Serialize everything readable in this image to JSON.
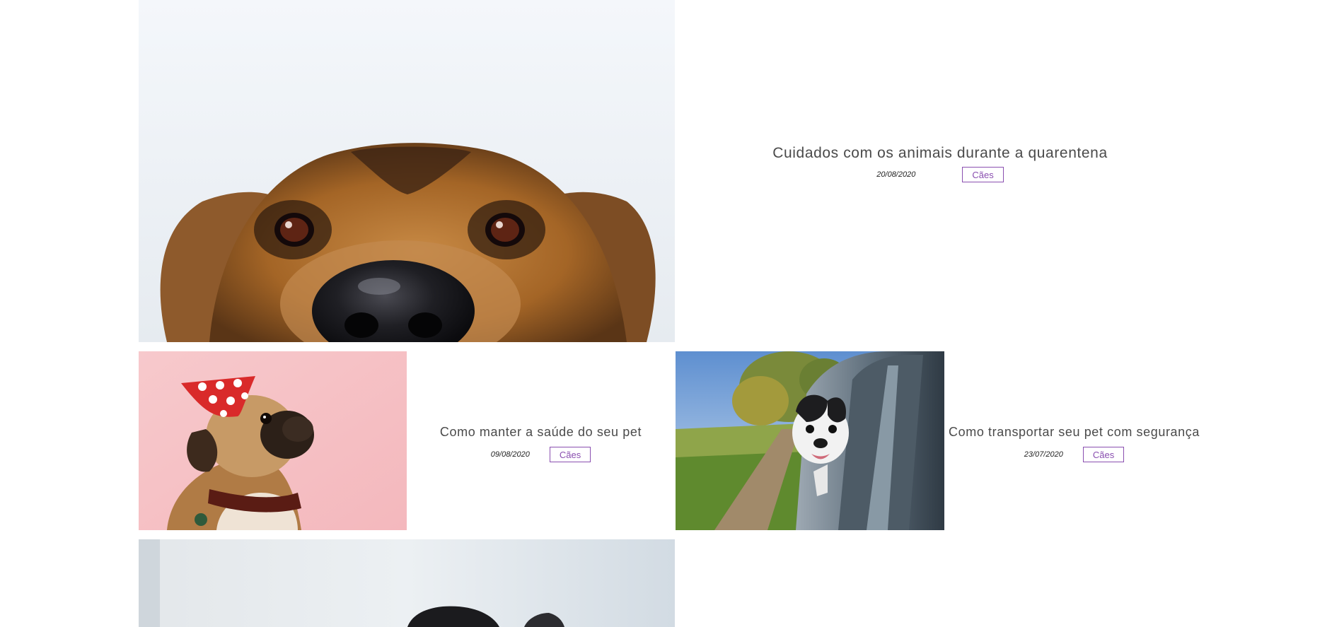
{
  "posts": [
    {
      "title": "Cuidados com os animais durante a quarentena",
      "date": "20/08/2020",
      "category": "Cães",
      "image": "dog-eyes-nose-photo"
    },
    {
      "title": "Como manter a saúde do seu pet",
      "date": "09/08/2020",
      "category": "Cães",
      "image": "pug-party-hat-photo"
    },
    {
      "title": "Como transportar seu pet com segurança",
      "date": "23/07/2020",
      "category": "Cães",
      "image": "dog-car-window-photo"
    },
    {
      "image": "dog-photo-partial"
    }
  ],
  "colors": {
    "accent": "#8a4fb0",
    "title_text": "#4a4a4a",
    "background": "#ffffff"
  }
}
